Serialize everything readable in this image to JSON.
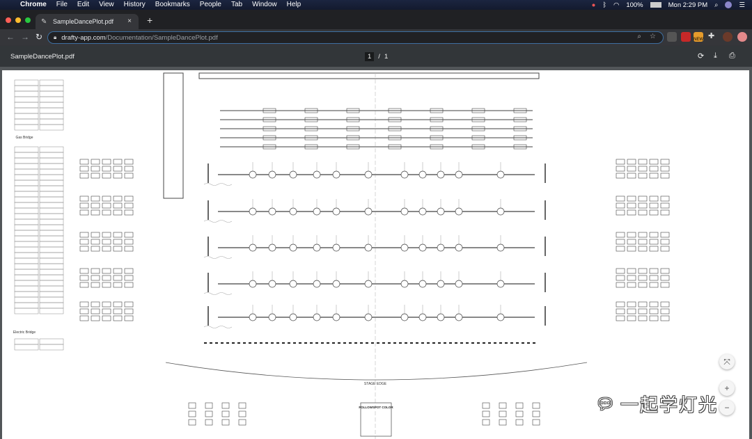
{
  "menubar": {
    "app": "Chrome",
    "items": [
      "File",
      "Edit",
      "View",
      "History",
      "Bookmarks",
      "People",
      "Tab",
      "Window",
      "Help"
    ],
    "battery": "100%",
    "clock": "Mon 2:29 PM"
  },
  "tab": {
    "title": "SampleDancePlot.pdf",
    "close": "×",
    "new_tab": "+"
  },
  "omnibox": {
    "domain": "drafty-app.com",
    "path": "/Documentation/SampleDancePlot.pdf"
  },
  "extensions": {
    "new_badge": "NEW"
  },
  "pdf": {
    "title": "SampleDancePlot.pdf",
    "current_page": "1",
    "separator": "/",
    "total_pages": "1"
  },
  "plot": {
    "stage_edge": "STAGE EDGE",
    "followspot_title": "FOLLOWSPOT COLOR",
    "bridge_label_top": "Gas Bridge",
    "bridge_label_bottom": "Electric Bridge",
    "electrics_count": 5
  },
  "zoom": {
    "fit": "⤧",
    "in": "+",
    "out": "−"
  },
  "watermark": {
    "text": "一起学灯光"
  }
}
